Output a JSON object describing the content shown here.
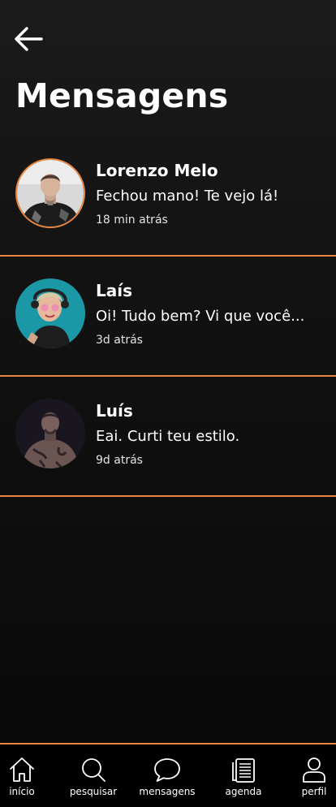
{
  "header": {
    "back_icon": "arrow-left-icon",
    "title": "Mensagens"
  },
  "colors": {
    "accent": "#e8853e",
    "background": "#121212",
    "text": "#ffffff"
  },
  "conversations": [
    {
      "name": "Lorenzo Melo",
      "preview": "Fechou mano! Te vejo lá!",
      "time": "18 min atrás",
      "unread": true
    },
    {
      "name": "Laís",
      "preview": "Oi! Tudo bem? Vi que você...",
      "time": "3d atrás",
      "unread": false
    },
    {
      "name": "Luís",
      "preview": "Eai. Curti teu estilo.",
      "time": "9d atrás",
      "unread": false
    }
  ],
  "bottom_nav": [
    {
      "label": "início",
      "icon": "home-icon"
    },
    {
      "label": "pesquisar",
      "icon": "search-icon"
    },
    {
      "label": "mensagens",
      "icon": "chat-bubble-icon"
    },
    {
      "label": "agenda",
      "icon": "agenda-icon"
    },
    {
      "label": "perfil",
      "icon": "user-icon"
    }
  ]
}
